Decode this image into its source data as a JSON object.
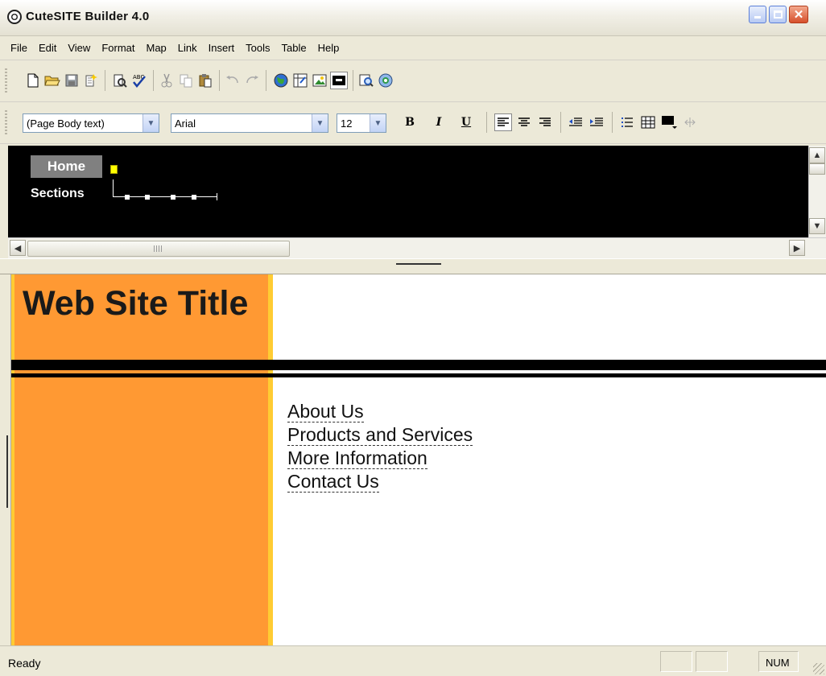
{
  "window": {
    "title": "CuteSITE Builder 4.0"
  },
  "menu": [
    "File",
    "Edit",
    "View",
    "Format",
    "Map",
    "Link",
    "Insert",
    "Tools",
    "Table",
    "Help"
  ],
  "toolbar_format": {
    "style_value": "(Page Body text)",
    "font_value": "Arial",
    "size_value": "12",
    "bold_label": "B",
    "italic_label": "I",
    "underline_label": "U"
  },
  "site_map": {
    "home_label": "Home",
    "sections_label": "Sections"
  },
  "page": {
    "site_title": "Web Site Title",
    "nav_links": [
      "About Us",
      "Products and Services",
      "More Information",
      "Contact Us"
    ],
    "colors": {
      "left_column": "#ff9933",
      "left_column_border": "#ffcc33"
    }
  },
  "status": {
    "text": "Ready",
    "num": "NUM"
  }
}
